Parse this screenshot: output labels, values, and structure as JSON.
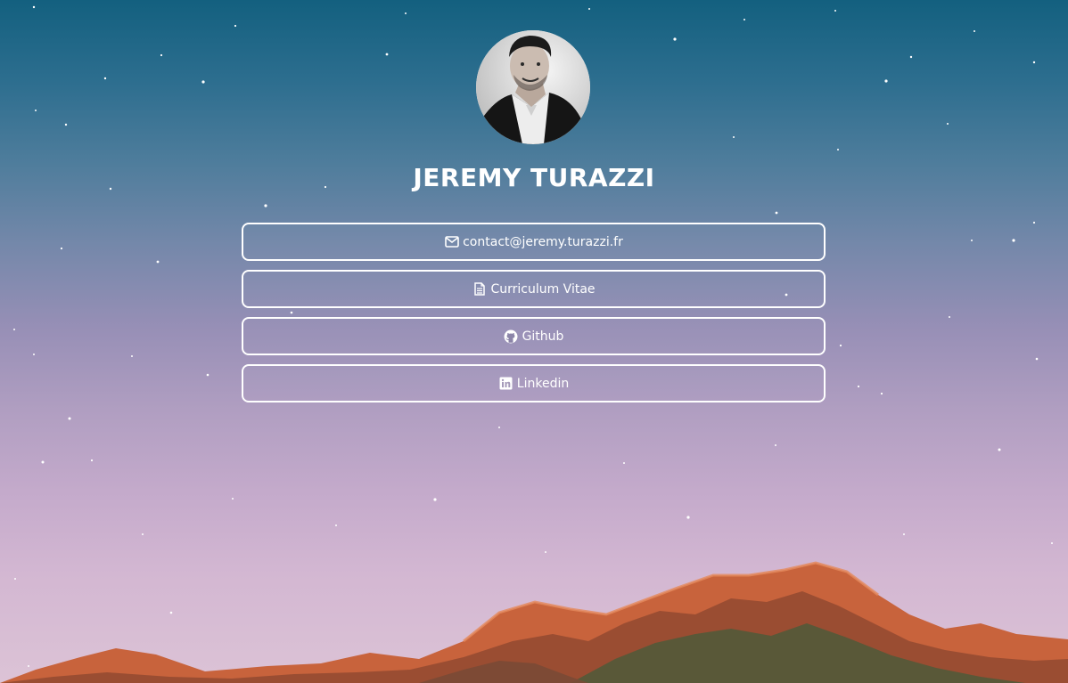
{
  "profile": {
    "name": "JEREMY TURAZZI",
    "avatar_icon": "profile-photo"
  },
  "links": [
    {
      "label": "contact@jeremy.turazzi.fr",
      "icon": "envelope-icon"
    },
    {
      "label": "Curriculum Vitae",
      "icon": "file-text-icon"
    },
    {
      "label": "Github",
      "icon": "github-icon"
    },
    {
      "label": "Linkedin",
      "icon": "linkedin-icon"
    }
  ],
  "colors": {
    "text": "#ffffff",
    "border": "#ffffff",
    "sky_top": "#13607f",
    "sky_bottom": "#dcc3d6",
    "mountain": "#c8623a"
  }
}
